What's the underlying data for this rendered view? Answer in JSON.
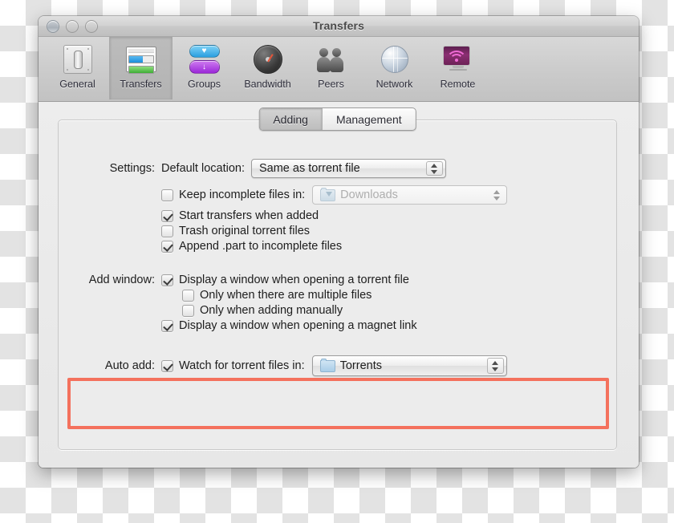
{
  "window": {
    "title": "Transfers",
    "traffic_lights": [
      "close-button",
      "minimize-button",
      "zoom-button"
    ]
  },
  "toolbar": {
    "items": [
      {
        "label": "General",
        "icon": "general-icon",
        "selected": false
      },
      {
        "label": "Transfers",
        "icon": "transfers-icon",
        "selected": true
      },
      {
        "label": "Groups",
        "icon": "groups-icon",
        "selected": false
      },
      {
        "label": "Bandwidth",
        "icon": "bandwidth-icon",
        "selected": false
      },
      {
        "label": "Peers",
        "icon": "peers-icon",
        "selected": false
      },
      {
        "label": "Network",
        "icon": "network-icon",
        "selected": false
      },
      {
        "label": "Remote",
        "icon": "remote-icon",
        "selected": false
      }
    ]
  },
  "tabs": [
    {
      "label": "Adding",
      "active": true
    },
    {
      "label": "Management",
      "active": false
    }
  ],
  "settings": {
    "group_label": "Settings:",
    "default_location_label": "Default location:",
    "default_location_value": "Same as torrent file",
    "keep_incomplete": {
      "label": "Keep incomplete files in:",
      "checked": false,
      "popup_value": "Downloads",
      "popup_disabled": true,
      "popup_icon": "downloads-folder-icon"
    },
    "checkboxes": [
      {
        "label": "Start transfers when added",
        "checked": true
      },
      {
        "label": "Trash original torrent files",
        "checked": false
      },
      {
        "label": "Append .part to incomplete files",
        "checked": true
      }
    ]
  },
  "add_window": {
    "group_label": "Add window:",
    "checkboxes": [
      {
        "label": "Display a window when opening a torrent file",
        "checked": true,
        "indent": 0
      },
      {
        "label": "Only when there are multiple files",
        "checked": false,
        "indent": 1
      },
      {
        "label": "Only when adding manually",
        "checked": false,
        "indent": 1
      },
      {
        "label": "Display a window when opening a magnet link",
        "checked": true,
        "indent": 0
      }
    ]
  },
  "auto_add": {
    "group_label": "Auto add:",
    "checkbox_label": "Watch for torrent files in:",
    "checked": true,
    "popup_value": "Torrents",
    "popup_icon": "folder-icon",
    "highlight_color": "#f4715d"
  }
}
